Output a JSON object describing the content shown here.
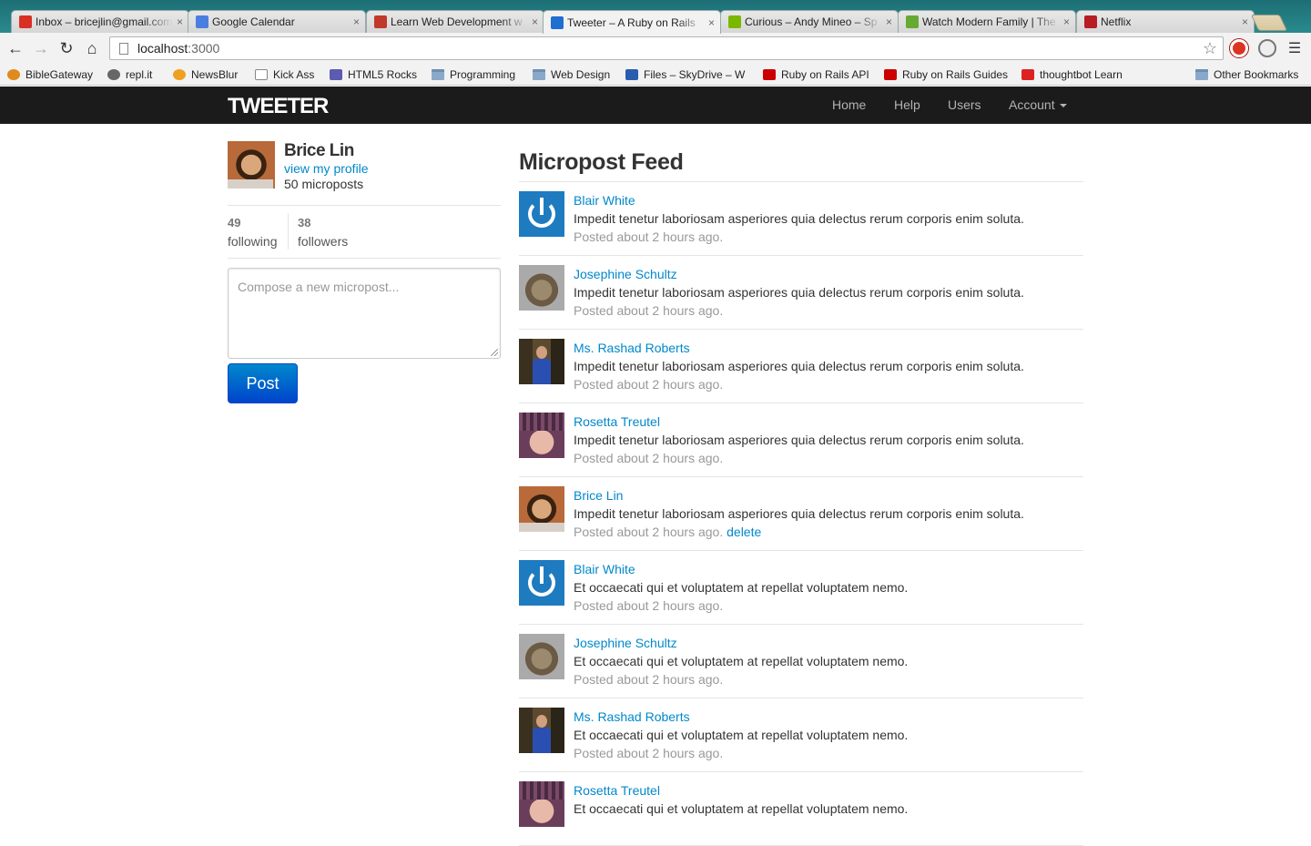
{
  "browser": {
    "tabs": [
      {
        "title": "Inbox – bricejlin@gmail.com",
        "icon": "gmail-icon",
        "color": "#d93025"
      },
      {
        "title": "Google Calendar",
        "icon": "calendar-icon",
        "color": "#4a7fe0"
      },
      {
        "title": "Learn Web Development w",
        "icon": "treehouse-icon",
        "color": "#c0392b"
      },
      {
        "title": "Tweeter – A Ruby on Rails",
        "icon": "bootstrap-icon",
        "color": "#1e6fd0"
      },
      {
        "title": "Curious – Andy Mineo – Sp",
        "icon": "spotify-icon",
        "color": "#7ab800"
      },
      {
        "title": "Watch Modern Family | The",
        "icon": "hulu-icon",
        "color": "#66aa33"
      },
      {
        "title": "Netflix",
        "icon": "netflix-icon",
        "color": "#b81d24"
      }
    ],
    "active_tab": 3,
    "url_host": "localhost",
    "url_port": ":3000",
    "bookmarks": [
      {
        "label": "BibleGateway",
        "icon": "biblegateway-icon"
      },
      {
        "label": "repl.it",
        "icon": "replit-icon"
      },
      {
        "label": "NewsBlur",
        "icon": "newsblur-icon"
      },
      {
        "label": "Kick Ass",
        "icon": "page-icon"
      },
      {
        "label": "HTML5 Rocks",
        "icon": "html5-icon"
      },
      {
        "label": "Programming",
        "icon": "folder-icon"
      },
      {
        "label": "Web Design",
        "icon": "folder-icon"
      },
      {
        "label": "Files – SkyDrive – W",
        "icon": "skydrive-icon"
      },
      {
        "label": "Ruby on Rails API",
        "icon": "rails-icon"
      },
      {
        "label": "Ruby on Rails Guides",
        "icon": "rails-icon"
      },
      {
        "label": "thoughtbot Learn",
        "icon": "thoughtbot-icon"
      },
      {
        "label": "Other Bookmarks",
        "icon": "folder-icon"
      }
    ]
  },
  "app": {
    "brand": "TWEETER",
    "nav": {
      "home": "Home",
      "help": "Help",
      "users": "Users",
      "account": "Account"
    }
  },
  "sidebar": {
    "name": "Brice Lin",
    "profile_link": "view my profile",
    "microposts_count": "50 microposts",
    "following_count": "49",
    "following_label": "following",
    "followers_count": "38",
    "followers_label": "followers",
    "compose_placeholder": "Compose a new micropost...",
    "post_button": "Post"
  },
  "feed": {
    "title": "Micropost Feed",
    "items": [
      {
        "user": "Blair White",
        "avatar": "gravatar",
        "content": "Impedit tenetur laboriosam asperiores quia delectus rerum corporis enim soluta.",
        "timestamp": "Posted about 2 hours ago.",
        "delete": ""
      },
      {
        "user": "Josephine Schultz",
        "avatar": "cat",
        "content": "Impedit tenetur laboriosam asperiores quia delectus rerum corporis enim soluta.",
        "timestamp": "Posted about 2 hours ago.",
        "delete": ""
      },
      {
        "user": "Ms. Rashad Roberts",
        "avatar": "rashad",
        "content": "Impedit tenetur laboriosam asperiores quia delectus rerum corporis enim soluta.",
        "timestamp": "Posted about 2 hours ago.",
        "delete": ""
      },
      {
        "user": "Rosetta Treutel",
        "avatar": "rosetta",
        "content": "Impedit tenetur laboriosam asperiores quia delectus rerum corporis enim soluta.",
        "timestamp": "Posted about 2 hours ago.",
        "delete": ""
      },
      {
        "user": "Brice Lin",
        "avatar": "brice",
        "content": "Impedit tenetur laboriosam asperiores quia delectus rerum corporis enim soluta.",
        "timestamp": "Posted about 2 hours ago.",
        "delete": "delete"
      },
      {
        "user": "Blair White",
        "avatar": "gravatar",
        "content": "Et occaecati qui et voluptatem at repellat voluptatem nemo.",
        "timestamp": "Posted about 2 hours ago.",
        "delete": ""
      },
      {
        "user": "Josephine Schultz",
        "avatar": "cat",
        "content": "Et occaecati qui et voluptatem at repellat voluptatem nemo.",
        "timestamp": "Posted about 2 hours ago.",
        "delete": ""
      },
      {
        "user": "Ms. Rashad Roberts",
        "avatar": "rashad",
        "content": "Et occaecati qui et voluptatem at repellat voluptatem nemo.",
        "timestamp": "Posted about 2 hours ago.",
        "delete": ""
      },
      {
        "user": "Rosetta Treutel",
        "avatar": "rosetta",
        "content": "Et occaecati qui et voluptatem at repellat voluptatem nemo.",
        "timestamp": "",
        "delete": ""
      }
    ]
  }
}
